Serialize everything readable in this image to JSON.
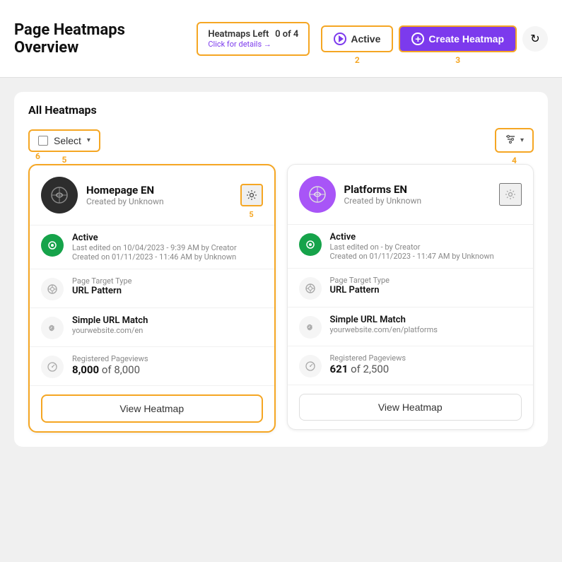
{
  "header": {
    "title": "Page Heatmaps Overview",
    "heatmaps_left": {
      "label": "Heatmaps Left",
      "link_text": "Click for details →",
      "count": "0 of 4"
    },
    "active_button": "Active",
    "create_button": "Create Heatmap",
    "refresh_icon": "↻",
    "badge_2": "2",
    "badge_3": "3"
  },
  "main": {
    "section_title": "All Heatmaps",
    "toolbar": {
      "select_label": "Select",
      "filter_label": "",
      "badge_4": "4",
      "badge_5": "5"
    },
    "cards": [
      {
        "id": "homepage-en",
        "name": "Homepage EN",
        "creator": "Created by Unknown",
        "avatar_type": "dark",
        "avatar_icon": "🔗",
        "highlighted": true,
        "status": "Active",
        "last_edited": "Last edited on 10/04/2023 - 9:39 AM by Creator",
        "created_on": "Created on 01/11/2023 - 11:46 AM by Unknown",
        "page_target_label": "Page Target Type",
        "page_target_value": "URL Pattern",
        "url_match_label": "Simple URL Match",
        "url_match_value": "yourwebsite.com/en",
        "pageviews_label": "Registered Pageviews",
        "pageviews_value": "8,000",
        "pageviews_total": "of 8,000",
        "view_button": "View Heatmap",
        "badge_5": "5"
      },
      {
        "id": "platforms-en",
        "name": "Platforms EN",
        "creator": "Created by Unknown",
        "avatar_type": "purple",
        "avatar_icon": "🔗",
        "highlighted": false,
        "status": "Active",
        "last_edited": "Last edited on - by Creator",
        "created_on": "Created on 01/11/2023 - 11:47 AM by Unknown",
        "page_target_label": "Page Target Type",
        "page_target_value": "URL Pattern",
        "url_match_label": "Simple URL Match",
        "url_match_value": "yourwebsite.com/en/platforms",
        "pageviews_label": "Registered Pageviews",
        "pageviews_value": "621",
        "pageviews_total": "of 2,500",
        "view_button": "View Heatmap"
      }
    ],
    "badge_6": "6"
  }
}
